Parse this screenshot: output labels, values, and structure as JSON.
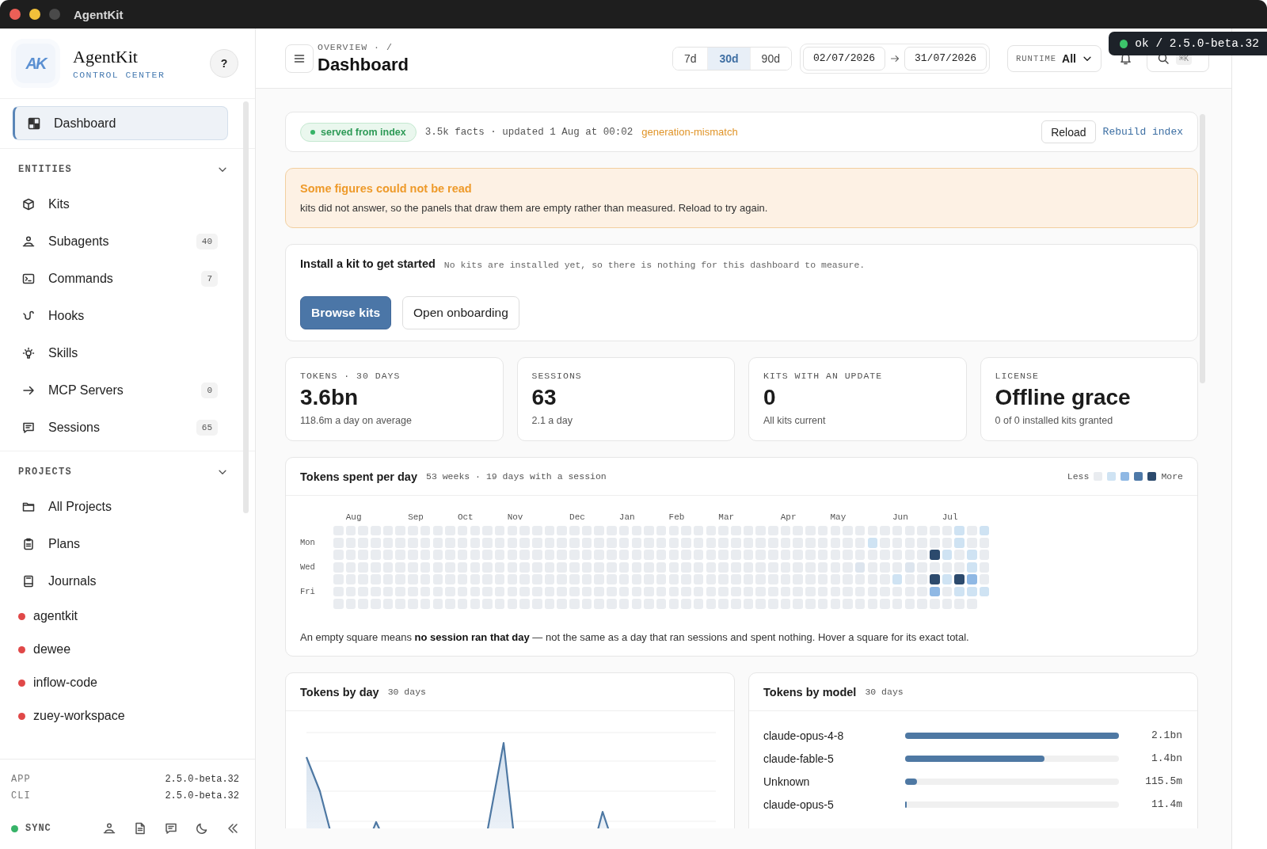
{
  "window": {
    "title": "AgentKit"
  },
  "sidebar": {
    "brand": {
      "logo": "AK",
      "name": "AgentKit",
      "subtitle": "CONTROL CENTER"
    },
    "help_button": "?",
    "nav": [
      {
        "label": "Dashboard",
        "selected": true
      }
    ],
    "sections": [
      {
        "title": "ENTITIES",
        "expanded": true,
        "items": [
          {
            "label": "Kits",
            "selected": false
          },
          {
            "label": "Subagents",
            "count": "40",
            "selected": false
          },
          {
            "label": "Commands",
            "count": "7",
            "selected": false
          },
          {
            "label": "Hooks",
            "selected": false
          },
          {
            "label": "Skills",
            "selected": false
          },
          {
            "label": "MCP Servers",
            "count": "0",
            "selected": false
          },
          {
            "label": "Sessions",
            "count": "65",
            "selected": false
          }
        ]
      },
      {
        "title": "PROJECTS",
        "expanded": true,
        "items": [
          {
            "label": "All Projects",
            "selected": false
          },
          {
            "label": "Plans",
            "selected": false
          },
          {
            "label": "Journals",
            "selected": false
          }
        ],
        "projects": [
          {
            "name": "agentkit",
            "color": "#e04848"
          },
          {
            "name": "dewee",
            "color": "#e04848"
          },
          {
            "name": "inflow-code",
            "color": "#e04848"
          },
          {
            "name": "zuey-workspace",
            "color": "#e04848"
          }
        ]
      }
    ],
    "versions": [
      {
        "label": "APP",
        "value": "2.5.0-beta.32"
      },
      {
        "label": "CLI",
        "value": "2.5.0-beta.32"
      }
    ],
    "sync": {
      "label": "SYNC",
      "on": true
    }
  },
  "header": {
    "breadcrumb": "OVERVIEW · /",
    "title": "Dashboard",
    "ranges": [
      {
        "label": "7d",
        "selected": false
      },
      {
        "label": "30d",
        "selected": true
      },
      {
        "label": "90d",
        "selected": false
      }
    ],
    "date_from": "02/07/2026",
    "date_to": "31/07/2026",
    "runtime": {
      "label": "RUNTIME",
      "value": "All"
    },
    "shortcut": "⌘K"
  },
  "toast": {
    "text": "ok / 2.5.0-beta.32",
    "ok": true
  },
  "index_bar": {
    "badge": "served from index",
    "info": "3.5k facts · updated 1 Aug at 00:02",
    "warning": "generation-mismatch",
    "buttons": [
      {
        "label": "Reload",
        "kind": "outline"
      },
      {
        "label": "Rebuild index",
        "kind": "link"
      }
    ]
  },
  "alert": {
    "title": "Some figures could not be read",
    "message": "kits did not answer, so the panels that draw them are empty rather than measured. Reload to try again."
  },
  "install": {
    "title": "Install a kit to get started",
    "note": "No kits are installed yet, so there is nothing for this dashboard to measure.",
    "buttons": [
      {
        "label": "Browse kits",
        "kind": "primary"
      },
      {
        "label": "Open onboarding",
        "kind": "outline"
      }
    ]
  },
  "stats": [
    {
      "label": "TOKENS · 30 DAYS",
      "value": "3.6bn",
      "note": "118.6m a day on average"
    },
    {
      "label": "SESSIONS",
      "value": "63",
      "note": "2.1 a day"
    },
    {
      "label": "KITS WITH AN UPDATE",
      "value": "0",
      "note": "All kits current"
    },
    {
      "label": "LICENSE",
      "value": "Offline grace",
      "note": "0 of 0 installed kits granted"
    }
  ],
  "heatmap": {
    "title": "Tokens spent per day",
    "subtitle": "53 weeks · 19 days with a session",
    "legend": {
      "less": "Less",
      "more": "More"
    },
    "months": [
      "Aug",
      "Sep",
      "Oct",
      "Nov",
      "Dec",
      "Jan",
      "Feb",
      "Mar",
      "Apr",
      "May",
      "Jun",
      "Jul"
    ],
    "weekdays": [
      "Mon",
      "Wed",
      "Fri"
    ],
    "rows": [
      {
        "cells": [
          {
            "color": "#e9ecf0"
          },
          {
            "color": "#e9ecf0"
          },
          {
            "color": "#e9ecf0"
          },
          {
            "color": "#e9ecf0"
          },
          {
            "color": "#e9ecf0"
          },
          {
            "color": "#e9ecf0"
          },
          {
            "color": "#e9ecf0"
          },
          {
            "color": "#e9ecf0"
          },
          {
            "color": "#e9ecf0"
          },
          {
            "color": "#e9ecf0"
          },
          {
            "color": "#e9ecf0"
          },
          {
            "color": "#e9ecf0"
          },
          {
            "color": "#e9ecf0"
          },
          {
            "color": "#e9ecf0"
          },
          {
            "color": "#e9ecf0"
          },
          {
            "color": "#e9ecf0"
          },
          {
            "color": "#e9ecf0"
          },
          {
            "color": "#e9ecf0"
          },
          {
            "color": "#e9ecf0"
          },
          {
            "color": "#e9ecf0"
          },
          {
            "color": "#e9ecf0"
          },
          {
            "color": "#e9ecf0"
          },
          {
            "color": "#e9ecf0"
          },
          {
            "color": "#e9ecf0"
          },
          {
            "color": "#e9ecf0"
          },
          {
            "color": "#e9ecf0"
          },
          {
            "color": "#e9ecf0"
          },
          {
            "color": "#e9ecf0"
          },
          {
            "color": "#e9ecf0"
          },
          {
            "color": "#e9ecf0"
          },
          {
            "color": "#e9ecf0"
          },
          {
            "color": "#e9ecf0"
          },
          {
            "color": "#e9ecf0"
          },
          {
            "color": "#e9ecf0"
          },
          {
            "color": "#e9ecf0"
          },
          {
            "color": "#e9ecf0"
          },
          {
            "color": "#e9ecf0"
          },
          {
            "color": "#e9ecf0"
          },
          {
            "color": "#e9ecf0"
          },
          {
            "color": "#e9ecf0"
          },
          {
            "color": "#e9ecf0"
          },
          {
            "color": "#e9ecf0"
          },
          {
            "color": "#e9ecf0"
          },
          {
            "color": "#e9ecf0"
          },
          {
            "color": "#e9ecf0"
          },
          {
            "color": "#e9ecf0"
          },
          {
            "color": "#e9ecf0"
          },
          {
            "color": "#e9ecf0"
          },
          {
            "color": "#e9ecf0"
          },
          {
            "color": "#e9ecf0"
          },
          {
            "color": "#cfe3f3"
          },
          {
            "color": "#e9ecf0"
          },
          {
            "color": "#cfe3f3"
          }
        ]
      },
      {
        "cells": [
          {
            "color": "#e9ecf0"
          },
          {
            "color": "#e9ecf0"
          },
          {
            "color": "#e9ecf0"
          },
          {
            "color": "#e9ecf0"
          },
          {
            "color": "#e9ecf0"
          },
          {
            "color": "#e9ecf0"
          },
          {
            "color": "#e9ecf0"
          },
          {
            "color": "#e9ecf0"
          },
          {
            "color": "#e9ecf0"
          },
          {
            "color": "#e9ecf0"
          },
          {
            "color": "#e9ecf0"
          },
          {
            "color": "#e9ecf0"
          },
          {
            "color": "#e9ecf0"
          },
          {
            "color": "#e9ecf0"
          },
          {
            "color": "#e9ecf0"
          },
          {
            "color": "#e9ecf0"
          },
          {
            "color": "#e9ecf0"
          },
          {
            "color": "#e9ecf0"
          },
          {
            "color": "#e9ecf0"
          },
          {
            "color": "#e9ecf0"
          },
          {
            "color": "#e9ecf0"
          },
          {
            "color": "#e9ecf0"
          },
          {
            "color": "#e9ecf0"
          },
          {
            "color": "#e9ecf0"
          },
          {
            "color": "#e9ecf0"
          },
          {
            "color": "#e9ecf0"
          },
          {
            "color": "#e9ecf0"
          },
          {
            "color": "#e9ecf0"
          },
          {
            "color": "#e9ecf0"
          },
          {
            "color": "#e9ecf0"
          },
          {
            "color": "#e9ecf0"
          },
          {
            "color": "#e9ecf0"
          },
          {
            "color": "#e9ecf0"
          },
          {
            "color": "#e9ecf0"
          },
          {
            "color": "#e9ecf0"
          },
          {
            "color": "#e9ecf0"
          },
          {
            "color": "#e9ecf0"
          },
          {
            "color": "#e9ecf0"
          },
          {
            "color": "#e9ecf0"
          },
          {
            "color": "#e9ecf0"
          },
          {
            "color": "#e9ecf0"
          },
          {
            "color": "#e9ecf0"
          },
          {
            "color": "#e9ecf0"
          },
          {
            "color": "#cfe3f3"
          },
          {
            "color": "#e9ecf0"
          },
          {
            "color": "#e9ecf0"
          },
          {
            "color": "#e9ecf0"
          },
          {
            "color": "#e9ecf0"
          },
          {
            "color": "#e9ecf0"
          },
          {
            "color": "#e9ecf0"
          },
          {
            "color": "#cfe3f3"
          },
          {
            "color": "#e9ecf0"
          },
          {
            "color": "#e9ecf0"
          }
        ]
      },
      {
        "cells": [
          {
            "color": "#e9ecf0"
          },
          {
            "color": "#e9ecf0"
          },
          {
            "color": "#e9ecf0"
          },
          {
            "color": "#e9ecf0"
          },
          {
            "color": "#e9ecf0"
          },
          {
            "color": "#e9ecf0"
          },
          {
            "color": "#e9ecf0"
          },
          {
            "color": "#e9ecf0"
          },
          {
            "color": "#e9ecf0"
          },
          {
            "color": "#e9ecf0"
          },
          {
            "color": "#e9ecf0"
          },
          {
            "color": "#e9ecf0"
          },
          {
            "color": "#e9ecf0"
          },
          {
            "color": "#e9ecf0"
          },
          {
            "color": "#e9ecf0"
          },
          {
            "color": "#e9ecf0"
          },
          {
            "color": "#e9ecf0"
          },
          {
            "color": "#e9ecf0"
          },
          {
            "color": "#e9ecf0"
          },
          {
            "color": "#e9ecf0"
          },
          {
            "color": "#e9ecf0"
          },
          {
            "color": "#e9ecf0"
          },
          {
            "color": "#e9ecf0"
          },
          {
            "color": "#e9ecf0"
          },
          {
            "color": "#e9ecf0"
          },
          {
            "color": "#e9ecf0"
          },
          {
            "color": "#e9ecf0"
          },
          {
            "color": "#e9ecf0"
          },
          {
            "color": "#e9ecf0"
          },
          {
            "color": "#e9ecf0"
          },
          {
            "color": "#e9ecf0"
          },
          {
            "color": "#e9ecf0"
          },
          {
            "color": "#e9ecf0"
          },
          {
            "color": "#e9ecf0"
          },
          {
            "color": "#e9ecf0"
          },
          {
            "color": "#e9ecf0"
          },
          {
            "color": "#e9ecf0"
          },
          {
            "color": "#e9ecf0"
          },
          {
            "color": "#e9ecf0"
          },
          {
            "color": "#e9ecf0"
          },
          {
            "color": "#e9ecf0"
          },
          {
            "color": "#e9ecf0"
          },
          {
            "color": "#e9ecf0"
          },
          {
            "color": "#e9ecf0"
          },
          {
            "color": "#e9ecf0"
          },
          {
            "color": "#e9ecf0"
          },
          {
            "color": "#e9ecf0"
          },
          {
            "color": "#e9ecf0"
          },
          {
            "color": "#2c4a6d"
          },
          {
            "color": "#cfe3f3"
          },
          {
            "color": "#e9ecf0"
          },
          {
            "color": "#cfe3f3"
          },
          {
            "color": "#e9ecf0"
          }
        ]
      },
      {
        "cells": [
          {
            "color": "#e9ecf0"
          },
          {
            "color": "#e9ecf0"
          },
          {
            "color": "#e9ecf0"
          },
          {
            "color": "#e9ecf0"
          },
          {
            "color": "#e9ecf0"
          },
          {
            "color": "#e9ecf0"
          },
          {
            "color": "#e9ecf0"
          },
          {
            "color": "#e9ecf0"
          },
          {
            "color": "#e9ecf0"
          },
          {
            "color": "#e9ecf0"
          },
          {
            "color": "#e9ecf0"
          },
          {
            "color": "#e9ecf0"
          },
          {
            "color": "#e9ecf0"
          },
          {
            "color": "#e9ecf0"
          },
          {
            "color": "#e9ecf0"
          },
          {
            "color": "#e9ecf0"
          },
          {
            "color": "#e9ecf0"
          },
          {
            "color": "#e9ecf0"
          },
          {
            "color": "#e9ecf0"
          },
          {
            "color": "#e9ecf0"
          },
          {
            "color": "#e9ecf0"
          },
          {
            "color": "#e9ecf0"
          },
          {
            "color": "#e9ecf0"
          },
          {
            "color": "#e9ecf0"
          },
          {
            "color": "#e9ecf0"
          },
          {
            "color": "#e9ecf0"
          },
          {
            "color": "#e9ecf0"
          },
          {
            "color": "#e9ecf0"
          },
          {
            "color": "#e9ecf0"
          },
          {
            "color": "#e9ecf0"
          },
          {
            "color": "#e9ecf0"
          },
          {
            "color": "#e9ecf0"
          },
          {
            "color": "#e9ecf0"
          },
          {
            "color": "#e9ecf0"
          },
          {
            "color": "#e9ecf0"
          },
          {
            "color": "#e9ecf0"
          },
          {
            "color": "#e9ecf0"
          },
          {
            "color": "#e9ecf0"
          },
          {
            "color": "#e9ecf0"
          },
          {
            "color": "#e9ecf0"
          },
          {
            "color": "#e9ecf0"
          },
          {
            "color": "#e9ecf0"
          },
          {
            "color": "#dde5ee"
          },
          {
            "color": "#e9ecf0"
          },
          {
            "color": "#e9ecf0"
          },
          {
            "color": "#e9ecf0"
          },
          {
            "color": "#dde5ee"
          },
          {
            "color": "#e9ecf0"
          },
          {
            "color": "#e9ecf0"
          },
          {
            "color": "#e9ecf0"
          },
          {
            "color": "#e9ecf0"
          },
          {
            "color": "#cfe3f3"
          },
          {
            "color": "#e9ecf0"
          }
        ]
      },
      {
        "cells": [
          {
            "color": "#e9ecf0"
          },
          {
            "color": "#e9ecf0"
          },
          {
            "color": "#e9ecf0"
          },
          {
            "color": "#e9ecf0"
          },
          {
            "color": "#e9ecf0"
          },
          {
            "color": "#e9ecf0"
          },
          {
            "color": "#e9ecf0"
          },
          {
            "color": "#e9ecf0"
          },
          {
            "color": "#e9ecf0"
          },
          {
            "color": "#e9ecf0"
          },
          {
            "color": "#e9ecf0"
          },
          {
            "color": "#e9ecf0"
          },
          {
            "color": "#e9ecf0"
          },
          {
            "color": "#e9ecf0"
          },
          {
            "color": "#e9ecf0"
          },
          {
            "color": "#e9ecf0"
          },
          {
            "color": "#e9ecf0"
          },
          {
            "color": "#e9ecf0"
          },
          {
            "color": "#e9ecf0"
          },
          {
            "color": "#e9ecf0"
          },
          {
            "color": "#e9ecf0"
          },
          {
            "color": "#e9ecf0"
          },
          {
            "color": "#e9ecf0"
          },
          {
            "color": "#e9ecf0"
          },
          {
            "color": "#e9ecf0"
          },
          {
            "color": "#e9ecf0"
          },
          {
            "color": "#e9ecf0"
          },
          {
            "color": "#e9ecf0"
          },
          {
            "color": "#e9ecf0"
          },
          {
            "color": "#e9ecf0"
          },
          {
            "color": "#e9ecf0"
          },
          {
            "color": "#e9ecf0"
          },
          {
            "color": "#e9ecf0"
          },
          {
            "color": "#e9ecf0"
          },
          {
            "color": "#e9ecf0"
          },
          {
            "color": "#e9ecf0"
          },
          {
            "color": "#e9ecf0"
          },
          {
            "color": "#e9ecf0"
          },
          {
            "color": "#e9ecf0"
          },
          {
            "color": "#e9ecf0"
          },
          {
            "color": "#e9ecf0"
          },
          {
            "color": "#e9ecf0"
          },
          {
            "color": "#e9ecf0"
          },
          {
            "color": "#e9ecf0"
          },
          {
            "color": "#e9ecf0"
          },
          {
            "color": "#cfe3f3"
          },
          {
            "color": "#e9ecf0"
          },
          {
            "color": "#e9ecf0"
          },
          {
            "color": "#2c4a6d"
          },
          {
            "color": "#cfe3f3"
          },
          {
            "color": "#2c4a6d"
          },
          {
            "color": "#8fb8e4"
          },
          {
            "color": "#e9ecf0"
          }
        ]
      },
      {
        "cells": [
          {
            "color": "#e9ecf0"
          },
          {
            "color": "#e9ecf0"
          },
          {
            "color": "#e9ecf0"
          },
          {
            "color": "#e9ecf0"
          },
          {
            "color": "#e9ecf0"
          },
          {
            "color": "#e9ecf0"
          },
          {
            "color": "#e9ecf0"
          },
          {
            "color": "#e9ecf0"
          },
          {
            "color": "#e9ecf0"
          },
          {
            "color": "#e9ecf0"
          },
          {
            "color": "#e9ecf0"
          },
          {
            "color": "#e9ecf0"
          },
          {
            "color": "#e9ecf0"
          },
          {
            "color": "#e9ecf0"
          },
          {
            "color": "#e9ecf0"
          },
          {
            "color": "#e9ecf0"
          },
          {
            "color": "#e9ecf0"
          },
          {
            "color": "#e9ecf0"
          },
          {
            "color": "#e9ecf0"
          },
          {
            "color": "#e9ecf0"
          },
          {
            "color": "#e9ecf0"
          },
          {
            "color": "#e9ecf0"
          },
          {
            "color": "#e9ecf0"
          },
          {
            "color": "#e9ecf0"
          },
          {
            "color": "#e9ecf0"
          },
          {
            "color": "#e9ecf0"
          },
          {
            "color": "#e9ecf0"
          },
          {
            "color": "#e9ecf0"
          },
          {
            "color": "#e9ecf0"
          },
          {
            "color": "#e9ecf0"
          },
          {
            "color": "#e9ecf0"
          },
          {
            "color": "#e9ecf0"
          },
          {
            "color": "#e9ecf0"
          },
          {
            "color": "#e9ecf0"
          },
          {
            "color": "#e9ecf0"
          },
          {
            "color": "#e9ecf0"
          },
          {
            "color": "#e9ecf0"
          },
          {
            "color": "#e9ecf0"
          },
          {
            "color": "#e9ecf0"
          },
          {
            "color": "#e9ecf0"
          },
          {
            "color": "#e9ecf0"
          },
          {
            "color": "#e9ecf0"
          },
          {
            "color": "#e9ecf0"
          },
          {
            "color": "#e9ecf0"
          },
          {
            "color": "#e9ecf0"
          },
          {
            "color": "#e9ecf0"
          },
          {
            "color": "#e9ecf0"
          },
          {
            "color": "#e9ecf0"
          },
          {
            "color": "#8fb8e4"
          },
          {
            "color": "#e9ecf0"
          },
          {
            "color": "#cfe3f3"
          },
          {
            "color": "#cfe3f3"
          },
          {
            "color": "#cfe3f3"
          }
        ]
      },
      {
        "cells": [
          {
            "color": "#e9ecf0"
          },
          {
            "color": "#e9ecf0"
          },
          {
            "color": "#e9ecf0"
          },
          {
            "color": "#e9ecf0"
          },
          {
            "color": "#e9ecf0"
          },
          {
            "color": "#e9ecf0"
          },
          {
            "color": "#e9ecf0"
          },
          {
            "color": "#e9ecf0"
          },
          {
            "color": "#e9ecf0"
          },
          {
            "color": "#e9ecf0"
          },
          {
            "color": "#e9ecf0"
          },
          {
            "color": "#e9ecf0"
          },
          {
            "color": "#e9ecf0"
          },
          {
            "color": "#e9ecf0"
          },
          {
            "color": "#e9ecf0"
          },
          {
            "color": "#e9ecf0"
          },
          {
            "color": "#e9ecf0"
          },
          {
            "color": "#e9ecf0"
          },
          {
            "color": "#e9ecf0"
          },
          {
            "color": "#e9ecf0"
          },
          {
            "color": "#e9ecf0"
          },
          {
            "color": "#e9ecf0"
          },
          {
            "color": "#e9ecf0"
          },
          {
            "color": "#e9ecf0"
          },
          {
            "color": "#e9ecf0"
          },
          {
            "color": "#e9ecf0"
          },
          {
            "color": "#e9ecf0"
          },
          {
            "color": "#e9ecf0"
          },
          {
            "color": "#e9ecf0"
          },
          {
            "color": "#e9ecf0"
          },
          {
            "color": "#e9ecf0"
          },
          {
            "color": "#e9ecf0"
          },
          {
            "color": "#e9ecf0"
          },
          {
            "color": "#e9ecf0"
          },
          {
            "color": "#e9ecf0"
          },
          {
            "color": "#e9ecf0"
          },
          {
            "color": "#e9ecf0"
          },
          {
            "color": "#e9ecf0"
          },
          {
            "color": "#e9ecf0"
          },
          {
            "color": "#e9ecf0"
          },
          {
            "color": "#e9ecf0"
          },
          {
            "color": "#e9ecf0"
          },
          {
            "color": "#e9ecf0"
          },
          {
            "color": "#e9ecf0"
          },
          {
            "color": "#e9ecf0"
          },
          {
            "color": "#e9ecf0"
          },
          {
            "color": "#e9ecf0"
          },
          {
            "color": "#e9ecf0"
          },
          {
            "color": "#e9ecf0"
          },
          {
            "color": "#e9ecf0"
          },
          {
            "color": "#e9ecf0"
          },
          {
            "color": "#e9ecf0"
          }
        ]
      }
    ],
    "footnote": "An empty square means **no session ran that day** — not the same as a day that ran sessions and spent nothing. Hover a square for its exact total."
  },
  "tokens_by_day": {
    "title": "Tokens by day",
    "subtitle": "30 days"
  },
  "tokens_by_model": {
    "title": "Tokens by model",
    "subtitle": "30 days",
    "rows": [
      {
        "model": "claude-opus-4-8",
        "level": 1,
        "value": "2.1bn"
      },
      {
        "model": "claude-fable-5",
        "level": 0.65,
        "value": "1.4bn"
      },
      {
        "model": "Unknown",
        "level": 0.055,
        "value": "115.5m"
      },
      {
        "model": "claude-opus-5",
        "level": 0.006,
        "value": "11.4m"
      }
    ]
  }
}
